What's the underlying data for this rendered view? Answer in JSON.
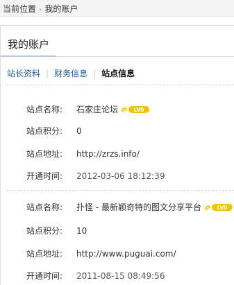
{
  "breadcrumb": {
    "current_label": "当前位置",
    "separator": "›",
    "page": "我的账户"
  },
  "page": {
    "title": "我的账户"
  },
  "tabs": [
    {
      "label": "站长资料",
      "active": false
    },
    {
      "label": "财务信息",
      "active": false
    },
    {
      "label": "站点信息",
      "active": true
    }
  ],
  "sites": [
    {
      "name_label": "站点名称:",
      "name": "石家庄论坛",
      "level": "LV0",
      "points_label": "站点积分:",
      "points": "0",
      "url_label": "站点地址:",
      "url": "http://zrzs.info/",
      "open_label": "开通时间:",
      "open_time": "2012-03-06 18:12:39"
    },
    {
      "name_label": "站点名称:",
      "name": "扑怪 - 最新颖奇特的图文分享平台",
      "level": "LV0",
      "points_label": "站点积分:",
      "points": "10",
      "url_label": "站点地址:",
      "url": "http://www.puguai.com/",
      "open_label": "开通时间:",
      "open_time": "2011-08-15 08:49:56"
    }
  ],
  "colors": {
    "link": "#1f5d99",
    "badge_fill": "#f2c200",
    "badge_text": "#ffffff"
  }
}
